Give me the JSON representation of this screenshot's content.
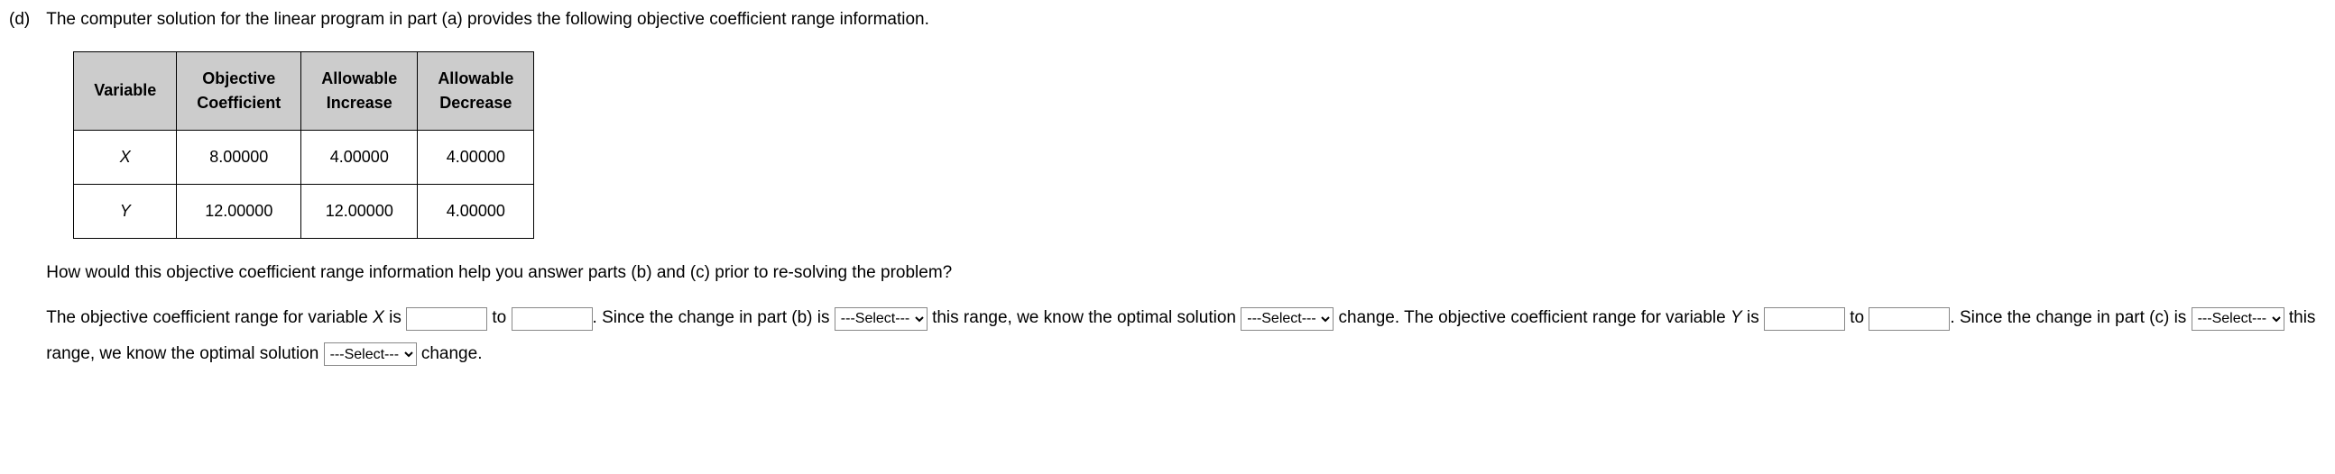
{
  "part_label": "(d)",
  "intro": "The computer solution for the linear program in part (a) provides the following objective coefficient range information.",
  "table": {
    "headers": [
      "Variable",
      "Objective Coefficient",
      "Allowable Increase",
      "Allowable Decrease"
    ],
    "rows": [
      {
        "var": "X",
        "obj": "8.00000",
        "inc": "4.00000",
        "dec": "4.00000"
      },
      {
        "var": "Y",
        "obj": "12.00000",
        "inc": "12.00000",
        "dec": "4.00000"
      }
    ]
  },
  "question": "How would this objective coefficient range information help you answer parts (b) and (c) prior to re-solving the problem?",
  "answer": {
    "seg1": "The objective coefficient range for variable ",
    "varX": "X",
    "seg2": " is ",
    "to": " to ",
    "seg3": ". Since the change in part (b) is ",
    "seg4": " this range, we know the optimal solution ",
    "seg5": " change. The objective coefficient range for variable ",
    "varY": "Y",
    "seg6": " is ",
    "seg7": ". Since the change in part (c) is ",
    "seg8": " this range, we know the optimal solution ",
    "seg9": " change."
  },
  "select_placeholder": "---Select---"
}
